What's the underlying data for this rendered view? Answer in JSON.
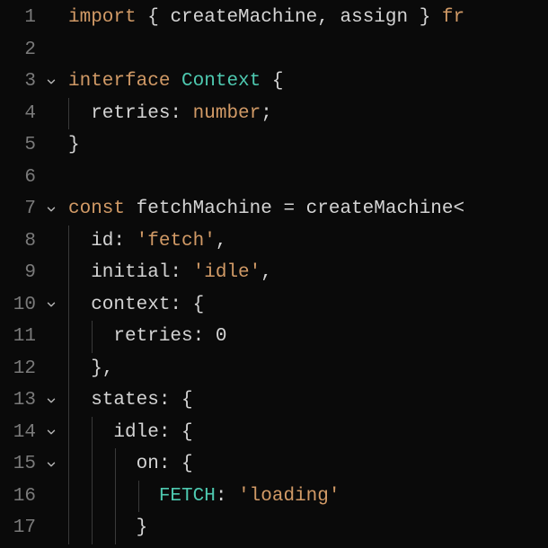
{
  "colors": {
    "background": "#0a0a0a",
    "foreground": "#d4d4d4",
    "lineno": "#7a7a7a",
    "keyword": "#d19a66",
    "type": "#4ec9b0",
    "string": "#d19a66",
    "const": "#4ec9b0"
  },
  "lines": [
    {
      "n": "1",
      "fold": false,
      "indent": 0,
      "tokens": [
        {
          "c": "tok-kw",
          "t": "import"
        },
        {
          "c": "tok-punct",
          "t": " { "
        },
        {
          "c": "tok-ident",
          "t": "createMachine"
        },
        {
          "c": "tok-punct",
          "t": ", "
        },
        {
          "c": "tok-ident",
          "t": "assign"
        },
        {
          "c": "tok-punct",
          "t": " } "
        },
        {
          "c": "tok-kw",
          "t": "fr"
        }
      ]
    },
    {
      "n": "2",
      "fold": false,
      "indent": 0,
      "tokens": []
    },
    {
      "n": "3",
      "fold": true,
      "indent": 0,
      "tokens": [
        {
          "c": "tok-kw",
          "t": "interface"
        },
        {
          "c": "tok-punct",
          "t": " "
        },
        {
          "c": "tok-type",
          "t": "Context"
        },
        {
          "c": "tok-punct",
          "t": " {"
        }
      ]
    },
    {
      "n": "4",
      "fold": false,
      "indent": 1,
      "tokens": [
        {
          "c": "tok-prop",
          "t": "  retries"
        },
        {
          "c": "tok-punct",
          "t": ": "
        },
        {
          "c": "tok-kw",
          "t": "number"
        },
        {
          "c": "tok-punct",
          "t": ";"
        }
      ]
    },
    {
      "n": "5",
      "fold": false,
      "indent": 0,
      "tokens": [
        {
          "c": "tok-punct",
          "t": "}"
        }
      ]
    },
    {
      "n": "6",
      "fold": false,
      "indent": 0,
      "tokens": []
    },
    {
      "n": "7",
      "fold": true,
      "indent": 0,
      "tokens": [
        {
          "c": "tok-kw",
          "t": "const"
        },
        {
          "c": "tok-punct",
          "t": " "
        },
        {
          "c": "tok-ident",
          "t": "fetchMachine"
        },
        {
          "c": "tok-punct",
          "t": " = "
        },
        {
          "c": "tok-func",
          "t": "createMachine"
        },
        {
          "c": "tok-punct",
          "t": "<"
        }
      ]
    },
    {
      "n": "8",
      "fold": false,
      "indent": 1,
      "tokens": [
        {
          "c": "tok-prop",
          "t": "  id"
        },
        {
          "c": "tok-punct",
          "t": ": "
        },
        {
          "c": "tok-string",
          "t": "'fetch'"
        },
        {
          "c": "tok-punct",
          "t": ","
        }
      ]
    },
    {
      "n": "9",
      "fold": false,
      "indent": 1,
      "tokens": [
        {
          "c": "tok-prop",
          "t": "  initial"
        },
        {
          "c": "tok-punct",
          "t": ": "
        },
        {
          "c": "tok-string",
          "t": "'idle'"
        },
        {
          "c": "tok-punct",
          "t": ","
        }
      ]
    },
    {
      "n": "10",
      "fold": true,
      "indent": 1,
      "tokens": [
        {
          "c": "tok-prop",
          "t": "  context"
        },
        {
          "c": "tok-punct",
          "t": ": {"
        }
      ]
    },
    {
      "n": "11",
      "fold": false,
      "indent": 2,
      "tokens": [
        {
          "c": "tok-prop",
          "t": "    retries"
        },
        {
          "c": "tok-punct",
          "t": ": "
        },
        {
          "c": "tok-num",
          "t": "0"
        }
      ]
    },
    {
      "n": "12",
      "fold": false,
      "indent": 1,
      "tokens": [
        {
          "c": "tok-punct",
          "t": "  },"
        }
      ]
    },
    {
      "n": "13",
      "fold": true,
      "indent": 1,
      "tokens": [
        {
          "c": "tok-prop",
          "t": "  states"
        },
        {
          "c": "tok-punct",
          "t": ": {"
        }
      ]
    },
    {
      "n": "14",
      "fold": true,
      "indent": 2,
      "tokens": [
        {
          "c": "tok-prop",
          "t": "    idle"
        },
        {
          "c": "tok-punct",
          "t": ": {"
        }
      ]
    },
    {
      "n": "15",
      "fold": true,
      "indent": 3,
      "tokens": [
        {
          "c": "tok-prop",
          "t": "      on"
        },
        {
          "c": "tok-punct",
          "t": ": {"
        }
      ]
    },
    {
      "n": "16",
      "fold": false,
      "indent": 4,
      "tokens": [
        {
          "c": "tok-punct",
          "t": "        "
        },
        {
          "c": "tok-const",
          "t": "FETCH"
        },
        {
          "c": "tok-punct",
          "t": ": "
        },
        {
          "c": "tok-string",
          "t": "'loading'"
        }
      ]
    },
    {
      "n": "17",
      "fold": false,
      "indent": 3,
      "tokens": [
        {
          "c": "tok-punct",
          "t": "      }"
        }
      ]
    }
  ]
}
